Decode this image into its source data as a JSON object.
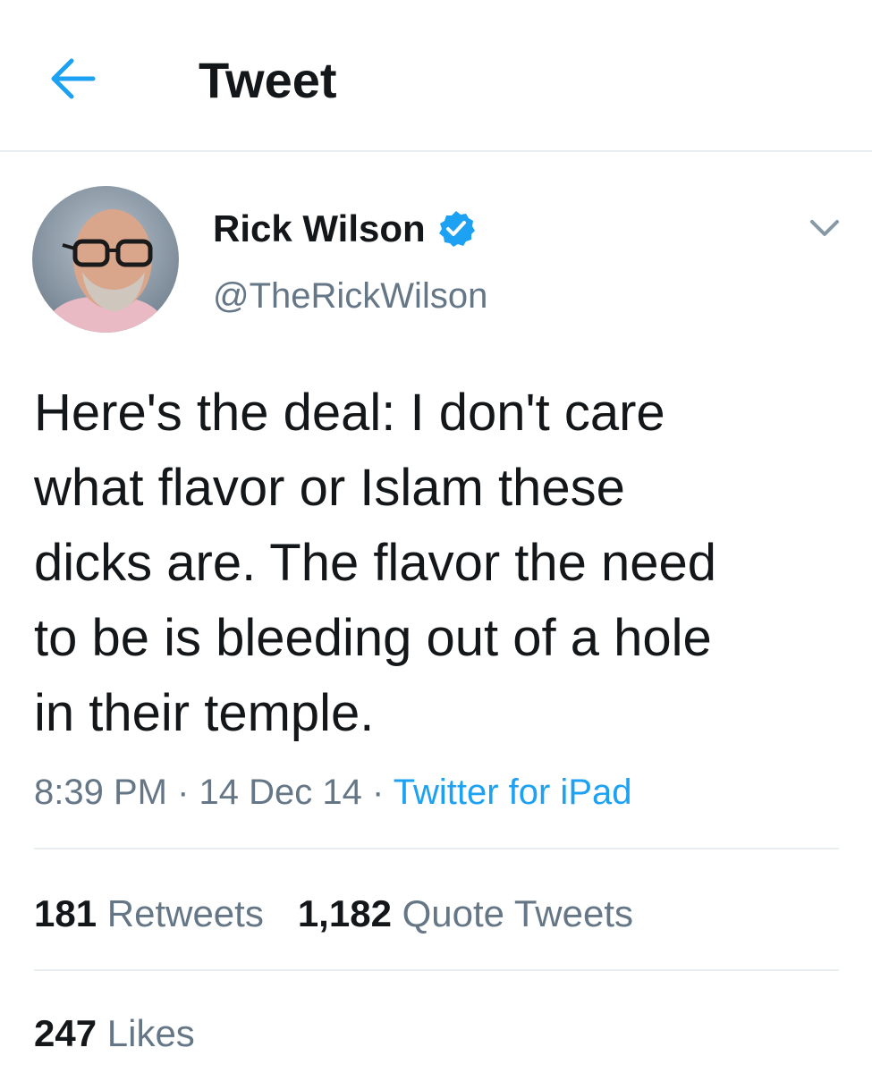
{
  "header": {
    "title": "Tweet",
    "back_icon": "arrow-left-icon"
  },
  "colors": {
    "accent": "#1da1f2",
    "text_primary": "#14171a",
    "text_secondary": "#657786",
    "divider": "#e6ecf0"
  },
  "author": {
    "display_name": "Rick Wilson",
    "handle": "@TheRickWilson",
    "verified": true,
    "verified_icon": "verified-badge-icon",
    "avatar_icon": "avatar"
  },
  "more_icon": "chevron-down-icon",
  "tweet": {
    "text": "Here's the deal: I don't care\nwhat flavor or Islam these\ndicks are. The flavor the need\nto be is bleeding out of a hole\nin their temple.",
    "time": "8:39 PM",
    "date": "14 Dec 14",
    "separator": "·",
    "source": "Twitter for iPad"
  },
  "stats": {
    "retweets_count": "181",
    "retweets_label": "Retweets",
    "quotes_count": "1,182",
    "quotes_label": "Quote Tweets",
    "likes_count": "247",
    "likes_label": "Likes"
  }
}
